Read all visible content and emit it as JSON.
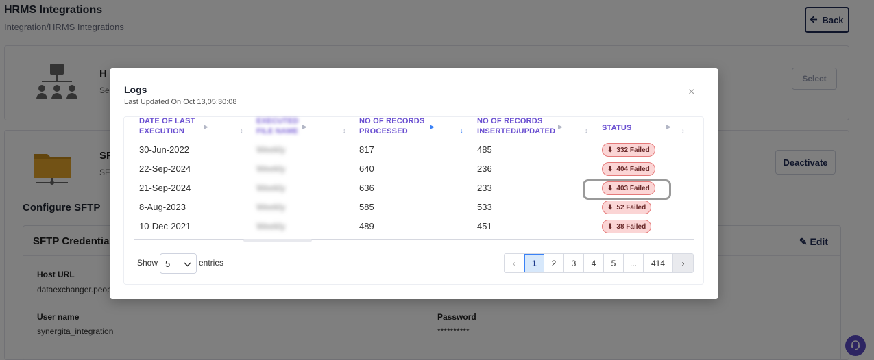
{
  "page": {
    "title": "HRMS Integrations",
    "breadcrumb": "Integration/HRMS Integrations",
    "back_label": "Back",
    "hrms_title": "H",
    "hrms_sub": "Se",
    "select_label": "Select",
    "sftp_title": "SF",
    "sftp_sub": "SF",
    "deactivate_label": "Deactivate",
    "configure_title": "Configure SFTP",
    "cred_title": "SFTP Credential",
    "edit_label": "Edit",
    "host_label": "Host URL",
    "host_value": "dataexchanger.peop",
    "user_label": "User name",
    "user_value": "synergita_integration",
    "password_label": "Password",
    "password_value": "**********"
  },
  "modal": {
    "title": "Logs",
    "subtitle": "Last Updated On Oct 13,05:30:08",
    "close": "×",
    "columns": [
      {
        "line1": "DATE OF LAST",
        "line2": "EXECUTION"
      },
      {
        "line1": "EXECUTED",
        "line2": "FILE NAME"
      },
      {
        "line1": "NO OF RECORDS",
        "line2": "PROCESSED"
      },
      {
        "line1": "NO OF RECORDS",
        "line2": "INSERTED/UPDATED"
      },
      {
        "line1": "STATUS",
        "line2": ""
      }
    ],
    "rows": [
      {
        "date": "30-Jun-2022",
        "file": "Weekly",
        "processed": "817",
        "inserted": "485",
        "status": "332 Failed"
      },
      {
        "date": "22-Sep-2024",
        "file": "Weekly",
        "processed": "640",
        "inserted": "236",
        "status": "404 Failed"
      },
      {
        "date": "21-Sep-2024",
        "file": "Weekly",
        "processed": "636",
        "inserted": "233",
        "status": "403 Failed"
      },
      {
        "date": "8-Aug-2023",
        "file": "Weekly",
        "processed": "585",
        "inserted": "533",
        "status": "52 Failed"
      },
      {
        "date": "10-Dec-2021",
        "file": "Weekly",
        "processed": "489",
        "inserted": "451",
        "status": "38 Failed"
      }
    ],
    "show_label": "Show",
    "page_size": "5",
    "entries_label": "entries",
    "pagination": [
      "‹",
      "1",
      "2",
      "3",
      "4",
      "5",
      "...",
      "414",
      "›"
    ]
  },
  "icons": {
    "back": "arrow-left-icon",
    "download": "download-icon",
    "sort": "sort-icon",
    "edit": "pencil-icon",
    "help": "headset-icon"
  },
  "colors": {
    "accent": "#6a4fd1",
    "failed_bg": "#fbd5d5",
    "failed_border": "#e57a7a",
    "active_page": "#d7e8fb",
    "primary_dark": "#1e2a55"
  }
}
